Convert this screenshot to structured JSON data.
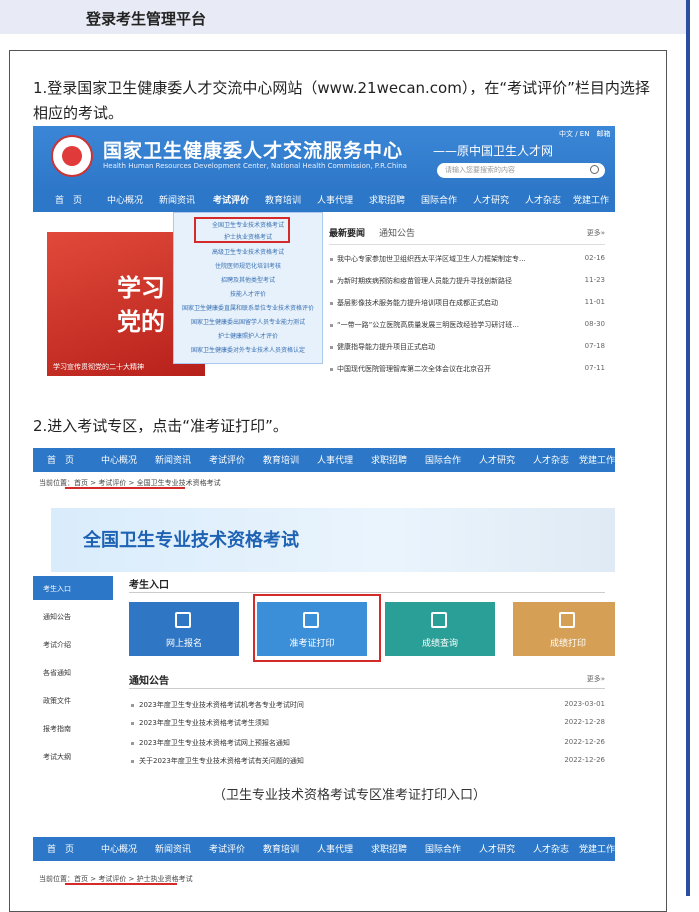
{
  "section_title": "登录考生管理平台",
  "step1": "1.登录国家卫生健康委人才交流中心网站（www.21wecan.com），在“考试评价”栏目内选择相应的考试。",
  "site": {
    "name": "国家卫生健康委人才交流服务中心",
    "english": "Health Human Resources Development Center, National Health Commission, P.R.China",
    "former": "——原中国卫生人才网",
    "lang": "中文 / EN",
    "mail": "邮箱",
    "search_placeholder": "请输入您要搜索的内容"
  },
  "nav": [
    "首　页",
    "中心概况",
    "新闻资讯",
    "考试评价",
    "教育培训",
    "人事代理",
    "求职招聘",
    "国际合作",
    "人才研究",
    "人才杂志",
    "党建工作"
  ],
  "dropdown": [
    "全国卫生专业技术资格考试",
    "护士执业资格考试",
    "高级卫生专业技术资格考试",
    "住院医师规范化培训考核",
    "招聘及其他类型考试",
    "技能人才评价",
    "国家卫生健康委直属和联系单位专业技术资格评价",
    "国家卫生健康委出国留学人员专业能力测试",
    "护士健康照护人才评价",
    "国家卫生健康委对外专业技术人员资格认定"
  ],
  "banner": {
    "line1": "学习",
    "line2": "党的",
    "caption": "学习宣传贯彻党的二十大精神"
  },
  "news": {
    "tab_active": "最新要闻",
    "tab_other": "通知公告",
    "more": "更多»",
    "items": [
      {
        "title": "我中心专家参加世卫组织西太平洋区域卫生人力框架制定专...",
        "date": "02-16"
      },
      {
        "title": "为新时期疾病预防和疫苗管理人员能力提升寻找创新路径",
        "date": "11-23"
      },
      {
        "title": "基层影像技术服务能力提升培训项目在成都正式启动",
        "date": "11-01"
      },
      {
        "title": "“一带一路”公立医院高质量发展三明医改经验学习研讨班...",
        "date": "08-30"
      },
      {
        "title": "健康指导能力提升项目正式启动",
        "date": "07-18"
      },
      {
        "title": "中国现代医院管理智库第二次全体会议在北京召开",
        "date": "07-11"
      }
    ]
  },
  "step2": "2.进入考试专区，点击“准考证打印”。",
  "breadcrumb": "当前位置：首页 > 考试评价 > 全国卫生专业技术资格考试",
  "exam_title": "全国卫生专业技术资格考试",
  "side_menu": [
    "考生入口",
    "通知公告",
    "考试介绍",
    "各省通知",
    "政策文件",
    "报考指南",
    "考试大纲"
  ],
  "section_entry": "考生入口",
  "tiles": [
    {
      "label": "网上报名",
      "color": "#2f76c4"
    },
    {
      "label": "准考证打印",
      "color": "#3b8fd9"
    },
    {
      "label": "成绩查询",
      "color": "#2a9f97"
    },
    {
      "label": "成绩打印",
      "color": "#d5a055"
    }
  ],
  "notices": {
    "label": "通知公告",
    "more": "更多»",
    "items": [
      {
        "title": "2023年度卫生专业技术资格考试机考各专业考试时间",
        "date": "2023-03-01"
      },
      {
        "title": "2023年度卫生专业技术资格考试考生须知",
        "date": "2022-12-28"
      },
      {
        "title": "2023年度卫生专业技术资格考试网上预报名通知",
        "date": "2022-12-26"
      },
      {
        "title": "关于2023年度卫生专业技术资格考试有关问题的通知",
        "date": "2022-12-26"
      }
    ]
  },
  "caption": "（卫生专业技术资格考试专区准考证打印入口）",
  "breadcrumb2": "当前位置：首页 > 考试评价 > 护士执业资格考试"
}
